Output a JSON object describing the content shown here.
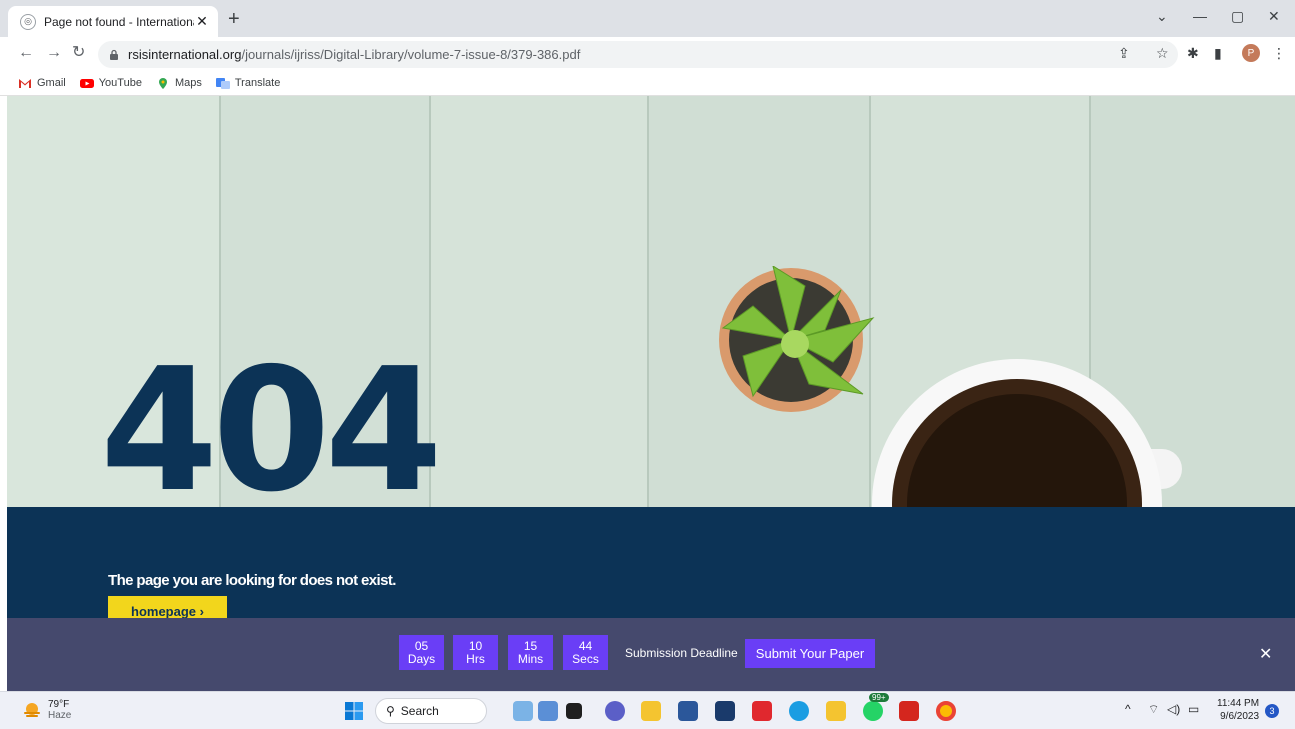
{
  "browser": {
    "tab_title": "Page not found - International Jo",
    "url_domain": "rsisinternational.org",
    "url_path": "/journals/ijriss/Digital-Library/volume-7-issue-8/379-386.pdf",
    "profile_initial": "P",
    "bookmarks": [
      {
        "label": "Gmail"
      },
      {
        "label": "YouTube"
      },
      {
        "label": "Maps"
      },
      {
        "label": "Translate"
      }
    ]
  },
  "page": {
    "error_code": "404",
    "message": "The page you are looking for does not exist.",
    "homepage_button": "homepage  ›",
    "countdown": [
      {
        "value": "05",
        "unit": "Days"
      },
      {
        "value": "10",
        "unit": "Hrs"
      },
      {
        "value": "15",
        "unit": "Mins"
      },
      {
        "value": "44",
        "unit": "Secs"
      }
    ],
    "deadline_label": "Submission Deadline",
    "submit_button": "Submit Your Paper",
    "close_symbol": "✕",
    "colors": {
      "navy": "#0c3356",
      "yellow": "#f2d61c",
      "purple": "#6a3ef6",
      "bar": "#45496d"
    }
  },
  "taskbar": {
    "weather_temp": "79°F",
    "weather_desc": "Haze",
    "search_label": "Search",
    "whatsapp_badge": "99+",
    "time": "11:44 PM",
    "date": "9/6/2023",
    "notification_count": "3"
  }
}
